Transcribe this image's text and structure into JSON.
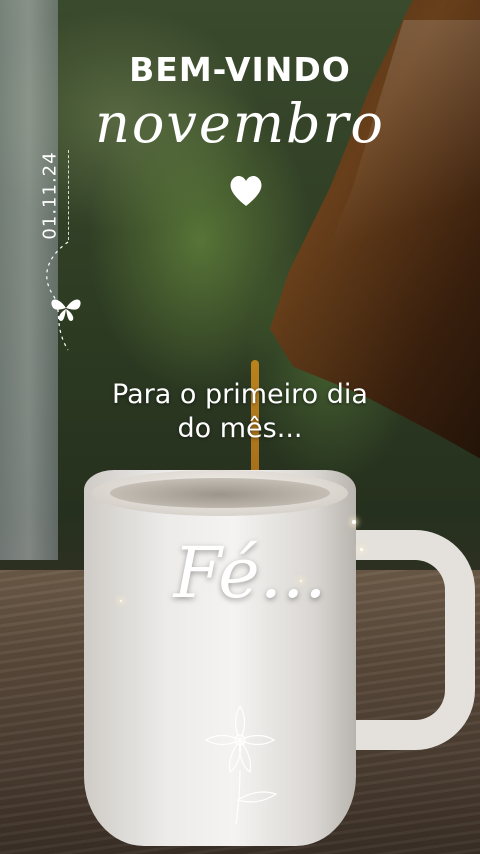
{
  "header": {
    "welcome_text": "BEM-VINDO",
    "month_text": "novembro",
    "heart_icon": "heart-icon"
  },
  "side": {
    "date_text": "01.11.24",
    "butterfly_icon": "butterfly-icon"
  },
  "message": {
    "line1": "Para o primeiro dia",
    "line2": "do mês..."
  },
  "mug": {
    "word": "Fé...",
    "flower_icon": "flower-icon"
  }
}
